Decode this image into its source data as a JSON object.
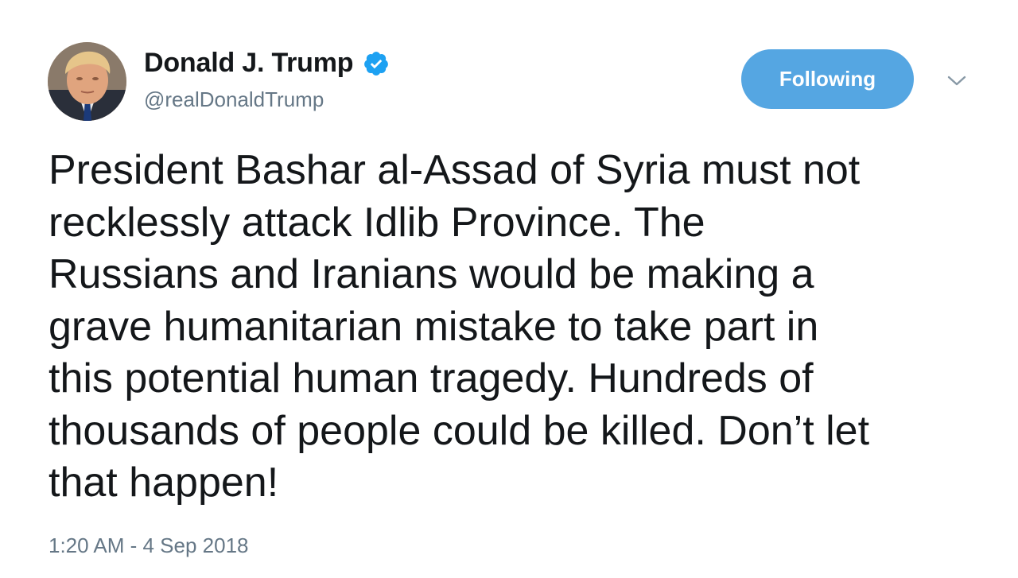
{
  "author": {
    "display_name": "Donald J. Trump",
    "handle": "@realDonaldTrump",
    "verified": true,
    "avatar_icon": "profile-photo"
  },
  "follow_button": {
    "label": "Following"
  },
  "menu": {
    "icon": "chevron-down-icon"
  },
  "tweet": {
    "text": "President Bashar al-Assad of Syria must not\nrecklessly attack Idlib Province. The\nRussians and Iranians would be making a\ngrave humanitarian mistake to take part in\nthis potential human tragedy. Hundreds of\nthousands of people could be killed. Don’t let\nthat happen!",
    "timestamp": "1:20 AM - 4 Sep 2018"
  },
  "colors": {
    "accent": "#1da1f2",
    "following_button": "#55a6e2",
    "text": "#14171a",
    "secondary_text": "#657786"
  }
}
